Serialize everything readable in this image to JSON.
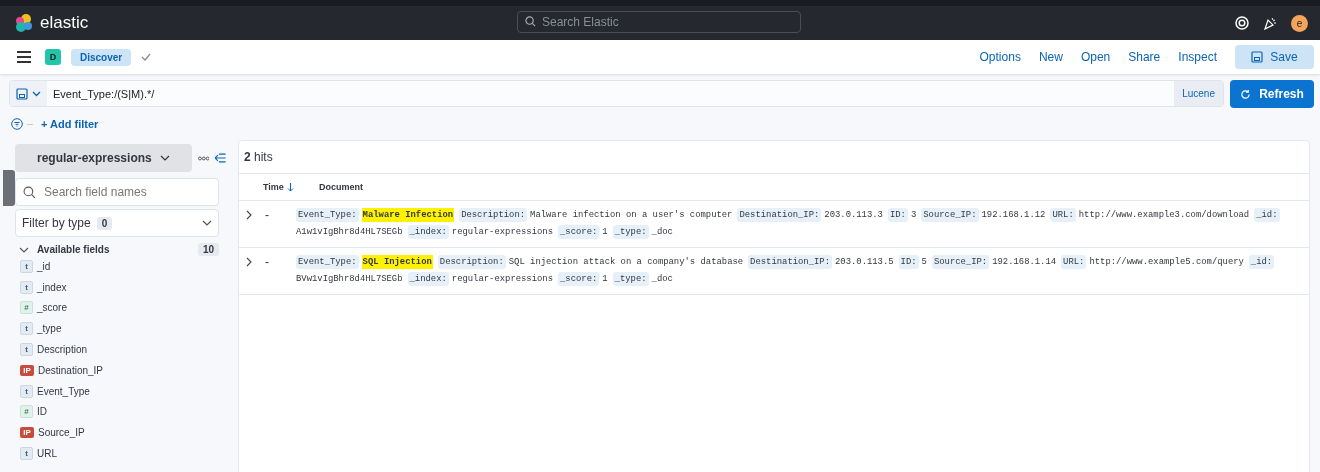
{
  "header": {
    "brand": "elastic",
    "search": {
      "placeholder": "Search Elastic"
    },
    "avatar": "e"
  },
  "app_bar": {
    "space": "D",
    "breadcrumb": "Discover",
    "links": [
      "Options",
      "New",
      "Open",
      "Share",
      "Inspect"
    ],
    "save": "Save"
  },
  "query_bar": {
    "value": "Event_Type:/(S|M).*/",
    "language": "Lucene",
    "refresh": "Refresh"
  },
  "filter_bar": {
    "add": "+ Add filter"
  },
  "sidebar": {
    "index_pattern": "regular-expressions",
    "search": {
      "placeholder": "Search field names"
    },
    "filter_by_type": {
      "label": "Filter by type",
      "count": "0"
    },
    "section": {
      "title": "Available fields",
      "count": "10",
      "expanded": true
    },
    "fields": [
      {
        "name": "_id",
        "kind": "string",
        "token": "t"
      },
      {
        "name": "_index",
        "kind": "string",
        "token": "t"
      },
      {
        "name": "_score",
        "kind": "number",
        "token": "#"
      },
      {
        "name": "_type",
        "kind": "string",
        "token": "t"
      },
      {
        "name": "Description",
        "kind": "string",
        "token": "t"
      },
      {
        "name": "Destination_IP",
        "kind": "ip",
        "token": "IP"
      },
      {
        "name": "Event_Type",
        "kind": "string",
        "token": "t"
      },
      {
        "name": "ID",
        "kind": "number",
        "token": "#"
      },
      {
        "name": "Source_IP",
        "kind": "ip",
        "token": "IP"
      },
      {
        "name": "URL",
        "kind": "string",
        "token": "t"
      }
    ]
  },
  "results": {
    "hits": "2",
    "hits_label": "hits",
    "columns": [
      "Time",
      "Document"
    ],
    "rows": [
      {
        "time": "-",
        "expanded": false,
        "fields": [
          {
            "key": "Event_Type:",
            "value": "Malware Infection",
            "highlighted": true
          },
          {
            "key": "Description:",
            "value": "Malware infection on a user's computer",
            "highlighted": false
          },
          {
            "key": "Destination_IP:",
            "value": "203.0.113.3",
            "highlighted": false
          },
          {
            "key": "ID:",
            "value": "3",
            "highlighted": false
          },
          {
            "key": "Source_IP:",
            "value": "192.168.1.12",
            "highlighted": false
          },
          {
            "key": "URL:",
            "value": "http://www.example3.com/download",
            "highlighted": false
          },
          {
            "key": "_id:",
            "value": "A1w1vIgBhr8d4HL7SEGb",
            "highlighted": false
          },
          {
            "key": "_index:",
            "value": "regular-expressions",
            "highlighted": false
          },
          {
            "key": "_score:",
            "value": "1",
            "highlighted": false
          },
          {
            "key": "_type:",
            "value": "_doc",
            "highlighted": false
          }
        ]
      },
      {
        "time": "-",
        "expanded": false,
        "fields": [
          {
            "key": "Event_Type:",
            "value": "SQL Injection",
            "highlighted": true
          },
          {
            "key": "Description:",
            "value": "SQL injection attack on a company's database",
            "highlighted": false
          },
          {
            "key": "Destination_IP:",
            "value": "203.0.113.5",
            "highlighted": false
          },
          {
            "key": "ID:",
            "value": "5",
            "highlighted": false
          },
          {
            "key": "Source_IP:",
            "value": "192.168.1.14",
            "highlighted": false
          },
          {
            "key": "URL:",
            "value": "http://www.example5.com/query",
            "highlighted": false
          },
          {
            "key": "_id:",
            "value": "BVw1vIgBhr8d4HL7SEGb",
            "highlighted": false
          },
          {
            "key": "_index:",
            "value": "regular-expressions",
            "highlighted": false
          },
          {
            "key": "_score:",
            "value": "1",
            "highlighted": false
          },
          {
            "key": "_type:",
            "value": "_doc",
            "highlighted": false
          }
        ]
      }
    ]
  }
}
